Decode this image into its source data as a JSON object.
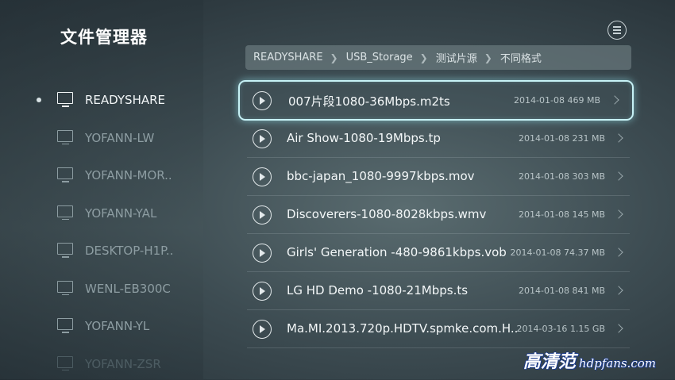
{
  "app": {
    "title": "文件管理器"
  },
  "devices": [
    {
      "label": "READYSHARE",
      "state": "active"
    },
    {
      "label": "YOFANN-LW",
      "state": "inactive"
    },
    {
      "label": "YOFANN-MOR..",
      "state": "inactive"
    },
    {
      "label": "YOFANN-YAL",
      "state": "inactive"
    },
    {
      "label": "DESKTOP-H1P..",
      "state": "inactive"
    },
    {
      "label": "WENL-EB300C",
      "state": "inactive"
    },
    {
      "label": "YOFANN-YL",
      "state": "inactive"
    },
    {
      "label": "YOFANN-ZSR",
      "state": "fade"
    }
  ],
  "breadcrumb": [
    "READYSHARE",
    "USB_Storage",
    "测试片源",
    "不同格式"
  ],
  "files": [
    {
      "name": "007片段1080-36Mbps.m2ts",
      "date": "2014-01-08",
      "size": "469 MB",
      "selected": true
    },
    {
      "name": "Air Show-1080-19Mbps.tp",
      "date": "2014-01-08",
      "size": "231 MB"
    },
    {
      "name": "bbc-japan_1080-9997kbps.mov",
      "date": "2014-01-08",
      "size": "303 MB"
    },
    {
      "name": "Discoverers-1080-8028kbps.wmv",
      "date": "2014-01-08",
      "size": "145 MB"
    },
    {
      "name": "Girls' Generation -480-9861kbps.vob",
      "date": "2014-01-08",
      "size": "74.37 MB"
    },
    {
      "name": "LG HD Demo -1080-21Mbps.ts",
      "date": "2014-01-08",
      "size": "841 MB"
    },
    {
      "name": "Ma.MI.2013.720p.HDTV.spmke.com.H..",
      "date": "2014-03-16",
      "size": "1.15 GB"
    }
  ],
  "icons": {
    "menu": "menu-icon",
    "play": "play-icon",
    "device": "monitor-icon",
    "chevron": "chevron-right-icon"
  },
  "colors": {
    "focus_glow": "#c7f2f6",
    "watermark_outline": "#1a3a8a"
  },
  "watermark": {
    "cn": "高清范",
    "en": "hdpfans.com"
  }
}
